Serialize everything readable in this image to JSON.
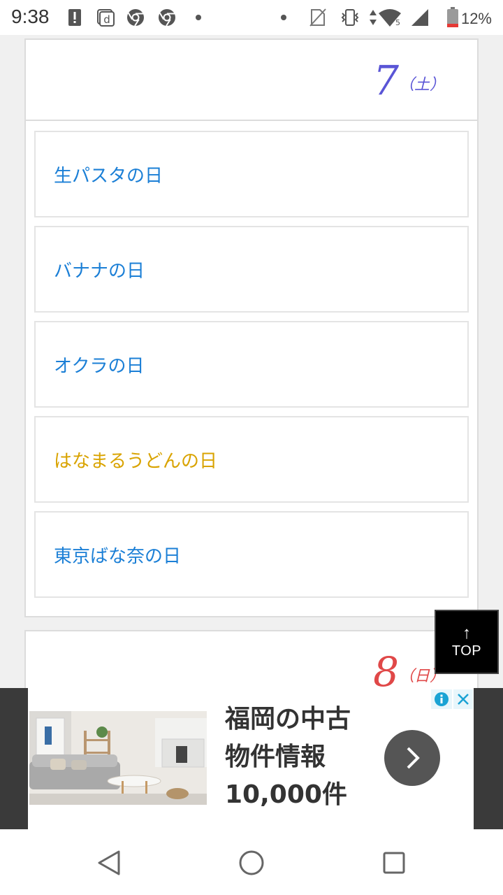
{
  "status_bar": {
    "time": "9:38",
    "battery": "12%",
    "signal_badge": "5",
    "icons": [
      "alert-icon",
      "docomo-d-icon",
      "chrome-icon",
      "chrome-icon",
      "dot-icon",
      "dot-icon",
      "no-sim-icon",
      "vibrate-icon",
      "data-arrows-icon",
      "wifi-icon",
      "signal-icon",
      "battery-icon"
    ]
  },
  "days": [
    {
      "number": "7",
      "weekday": "（土）",
      "color": "#5a55d6",
      "events": [
        {
          "label": "生パスタの日",
          "highlight": false
        },
        {
          "label": "バナナの日",
          "highlight": false
        },
        {
          "label": "オクラの日",
          "highlight": false
        },
        {
          "label": "はなまるうどんの日",
          "highlight": true
        },
        {
          "label": "東京ばな奈の日",
          "highlight": false
        }
      ]
    },
    {
      "number": "8",
      "weekday": "（日）",
      "color": "#e04848"
    }
  ],
  "top_button": {
    "arrow": "↑",
    "label": "TOP"
  },
  "ad": {
    "line1": "福岡の中古",
    "line2": "物件情報",
    "line3": "10,000件"
  },
  "colors": {
    "link": "#1b7fd6",
    "highlight": "#d9a300",
    "saturday": "#5a55d6",
    "sunday": "#e04848"
  },
  "nav": [
    "back-icon",
    "home-icon",
    "recents-icon"
  ]
}
